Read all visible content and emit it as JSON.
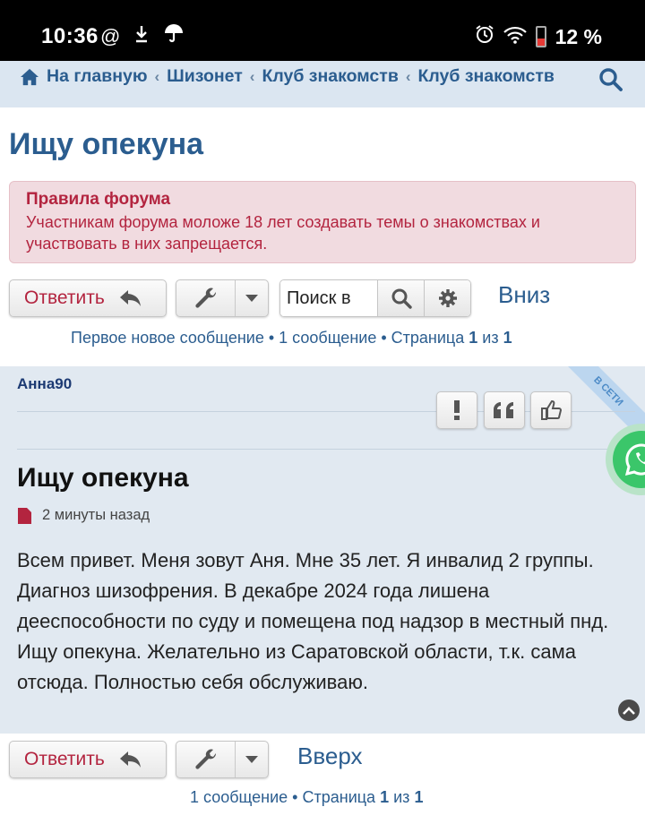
{
  "status_bar": {
    "time": "10:36",
    "left_icons": [
      "at-icon",
      "download-icon",
      "umbrella-icon"
    ],
    "battery": "12 %",
    "battery_level": 0.12
  },
  "breadcrumbs": [
    {
      "label": "На главную"
    },
    {
      "label": "Шизонет"
    },
    {
      "label": "Клуб знакомств"
    },
    {
      "label": "Клуб знакомств"
    }
  ],
  "page": {
    "title": "Ищу опекуна"
  },
  "notice": {
    "title": "Правила форума",
    "text": "Участникам форума моложе 18 лет создавать темы о знакомствах и участвовать в них запрещается."
  },
  "toolbar": {
    "reply_label": "Ответить",
    "search_placeholder": "Поиск в",
    "down_link": "Вниз",
    "up_link": "Вверх"
  },
  "pagination_top": {
    "first_new": "Первое новое сообщение",
    "count": "1 сообщение",
    "page_word": "Страница",
    "page_current": "1",
    "of_word": "из",
    "page_total": "1"
  },
  "pagination_bottom": {
    "count": "1 сообщение",
    "page_word": "Страница",
    "page_current": "1",
    "of_word": "из",
    "page_total": "1"
  },
  "post": {
    "author": "Анна90",
    "online_badge": "В СЕТИ",
    "title": "Ищу опекуна",
    "time": "2 минуты назад",
    "body": "Всем привет. Меня зовут Аня. Мне 35 лет. Я инвалид 2 группы. Диагноз шизофрения. В декабре 2024 года лишена дееспособности по суду и помещена под надзор в местный пнд. Ищу опекуна. Желательно из Саратовской области, т.к. сама отсюда. Полностью себя обслуживаю."
  },
  "colors": {
    "accent": "#2b5d8f",
    "notice_bg": "#f1dbe0",
    "notice_text": "#b3243f",
    "post_bg": "#e1e9f1",
    "nav_bg": "#dbe6f1"
  }
}
